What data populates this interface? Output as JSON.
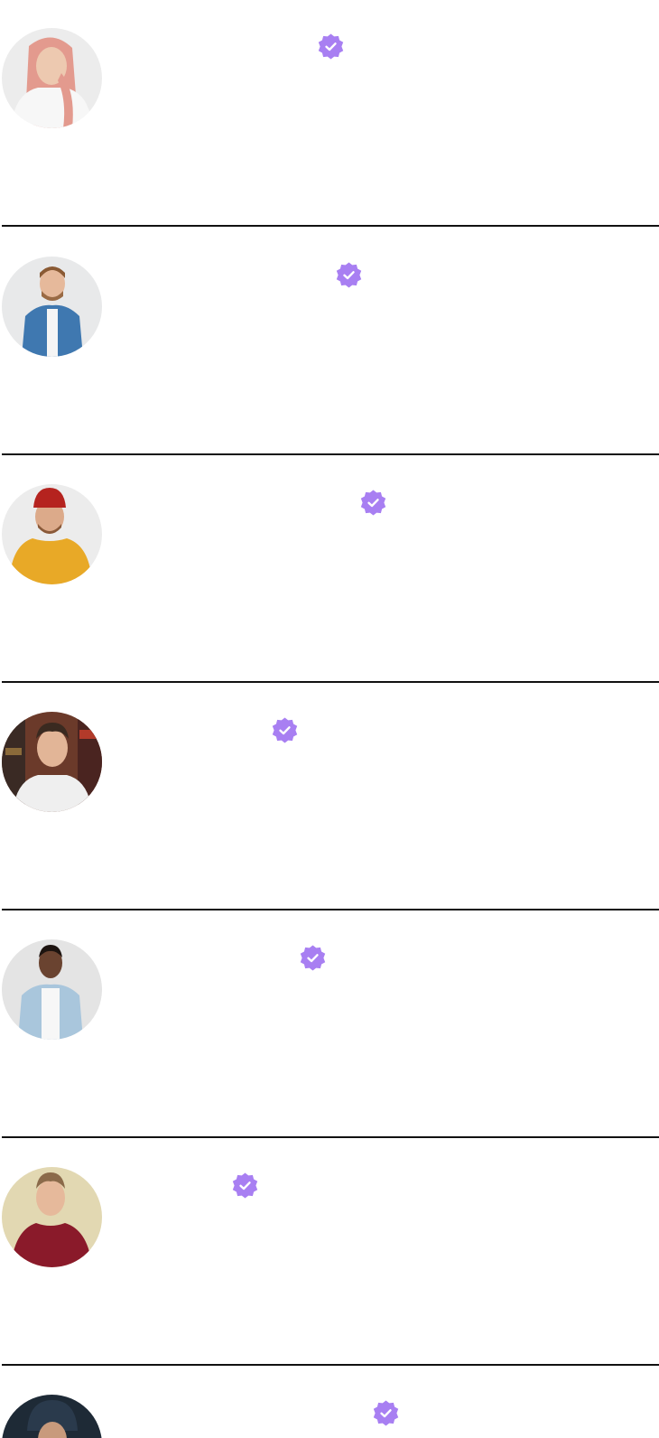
{
  "users": [
    {
      "avatar": "avatar-woman-pink-hair",
      "verified": true,
      "bg": "#ececec",
      "shirt": "#f7f7f7",
      "hair": "#e39a8e",
      "skin": "#edc9b0"
    },
    {
      "avatar": "avatar-man-denim-shirt",
      "verified": true,
      "bg": "#e8e9ea",
      "shirt": "#3f78b0",
      "hair": "#8a5a34",
      "skin": "#e6b99b"
    },
    {
      "avatar": "avatar-man-red-beanie",
      "verified": true,
      "bg": "#ececec",
      "shirt": "#e8a927",
      "hair": "#b5231f",
      "skin": "#dcaa8a"
    },
    {
      "avatar": "avatar-man-white-tee-shelves",
      "verified": true,
      "bg": "#6b3a2a",
      "shirt": "#efefef",
      "hair": "#3a2a20",
      "skin": "#e2b597"
    },
    {
      "avatar": "avatar-man-light-denim",
      "verified": true,
      "bg": "#e4e4e4",
      "shirt": "#a9c6dc",
      "hair": "#1d1410",
      "skin": "#6a4330"
    },
    {
      "avatar": "avatar-man-maroon-shirt",
      "verified": true,
      "bg": "#e2d8b2",
      "shirt": "#8a1a2a",
      "hair": "#8b6a4a",
      "skin": "#e6b99b"
    },
    {
      "avatar": "avatar-person-dark-cap",
      "verified": true,
      "bg": "#1e2a36",
      "shirt": "#243444",
      "hair": "#2a3a4c",
      "skin": "#c89a7c"
    }
  ],
  "colors": {
    "badge": "#a87ff2",
    "badge_check": "#ffffff",
    "divider": "#111111"
  }
}
